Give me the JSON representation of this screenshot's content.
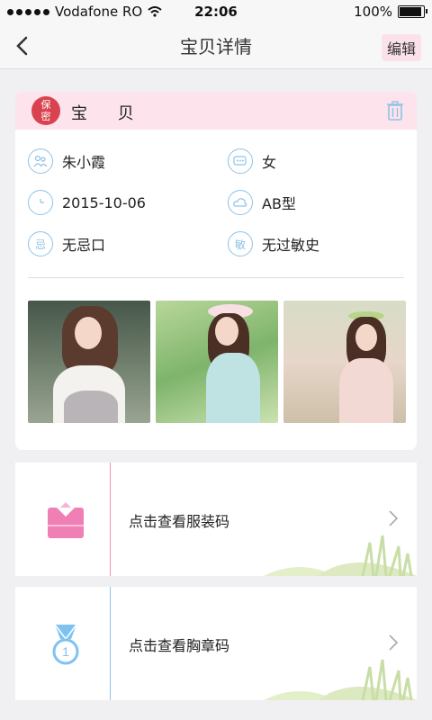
{
  "status": {
    "carrier": "Vodafone RO",
    "time": "22:06",
    "battery": "100%"
  },
  "nav": {
    "title": "宝贝详情",
    "edit_label": "编辑"
  },
  "profile": {
    "seal_text_top": "保",
    "seal_text_bottom": "密",
    "name": "宝 贝",
    "fields": [
      {
        "icon": "parents-icon",
        "value": "朱小霞"
      },
      {
        "icon": "gender-icon",
        "value": "女"
      },
      {
        "icon": "clock-icon",
        "value": "2015-10-06"
      },
      {
        "icon": "blood-type-icon",
        "value": "AB型"
      },
      {
        "icon": "avoid-icon",
        "glyph": "忌",
        "value": "无忌口"
      },
      {
        "icon": "allergy-icon",
        "glyph": "敏",
        "value": "无过敏史"
      }
    ]
  },
  "photos": [
    "photo-1",
    "photo-2",
    "photo-3"
  ],
  "menu": [
    {
      "label": "点击查看服装码",
      "icon": "clothing-icon",
      "accent": "#f48fb1"
    },
    {
      "label": "点击查看胸章码",
      "icon": "badge-medal-icon",
      "accent": "#8fc2e8",
      "medal_number": "1"
    }
  ],
  "colors": {
    "accent_pink": "#fce3ec",
    "accent_blue": "#8fc2e8"
  }
}
